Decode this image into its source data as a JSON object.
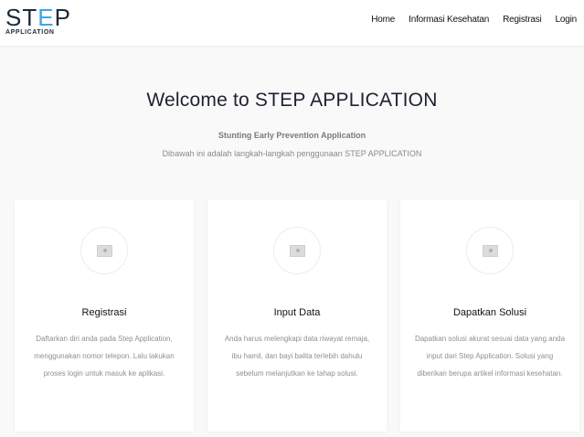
{
  "brand": {
    "logo_text_pre": "ST",
    "logo_text_hl": "E",
    "logo_text_post": "P",
    "logo_sub": "APPLICATION",
    "colors": {
      "dark": "#1b2a3a",
      "accent": "#3fa6e0"
    }
  },
  "nav": {
    "items": [
      {
        "label": "Home"
      },
      {
        "label": "Informasi Kesehatan"
      },
      {
        "label": "Registrasi"
      },
      {
        "label": "Login"
      }
    ]
  },
  "hero": {
    "title": "Welcome to STEP APPLICATION",
    "subtitle": "Stunting Early Prevention Application",
    "description": "Dibawah ini adalah langkah-langkah penggunaan STEP APPLICATION"
  },
  "cards": [
    {
      "icon": "image-placeholder-icon",
      "title": "Registrasi",
      "text": "Daftarkan diri anda pada Step Application, menggunakan nomor telepon. Lalu lakukan proses login untuk masuk ke aplikasi."
    },
    {
      "icon": "image-placeholder-icon",
      "title": "Input Data",
      "text": "Anda harus melengkapi data riwayat remaja, ibu hamil, dan bayi balita terlebih dahulu sebelum melanjutkan ke tahap solusi."
    },
    {
      "icon": "image-placeholder-icon",
      "title": "Dapatkan Solusi",
      "text": "Dapatkan solusi akurat sesuai data yang anda input dari Step Application. Solusi yang diberikan berupa artikel informasi kesehatan."
    }
  ]
}
